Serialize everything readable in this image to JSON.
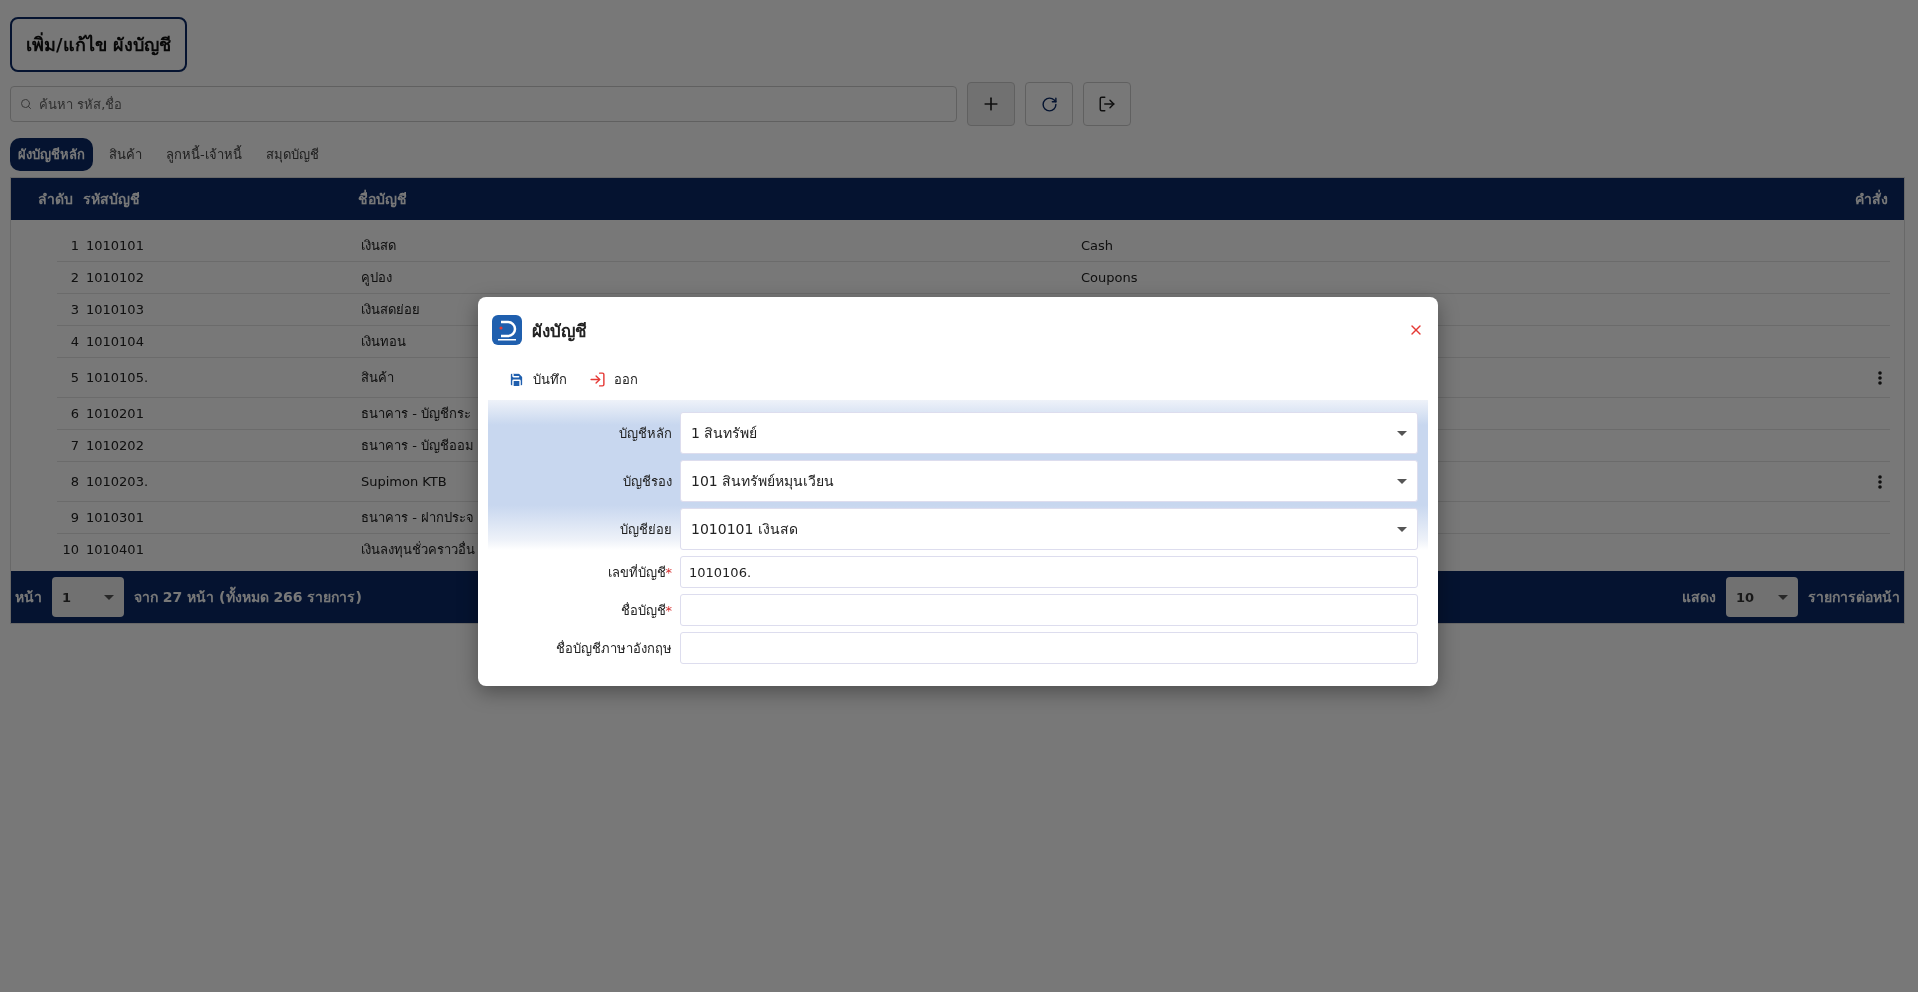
{
  "page": {
    "title": "เพิ่ม/แก้ไข ผังบัญชี"
  },
  "search": {
    "placeholder": "ค้นหา รหัส,ชื่อ"
  },
  "tabs": [
    {
      "label": "ผังบัญชีหลัก",
      "selected": true
    },
    {
      "label": "สินค้า",
      "selected": false
    },
    {
      "label": "ลูกหนี้-เจ้าหนี้",
      "selected": false
    },
    {
      "label": "สมุดบัญชี",
      "selected": false
    }
  ],
  "table": {
    "columns": [
      "ลำดับ",
      "รหัสบัญชี",
      "ชื่อบัญชี",
      "คำสั่ง"
    ],
    "rows": [
      {
        "order": "1",
        "code": "1010101",
        "name": "เงินสด",
        "name_en": "Cash",
        "menu": false
      },
      {
        "order": "2",
        "code": "1010102",
        "name": "คูปอง",
        "name_en": "Coupons",
        "menu": false
      },
      {
        "order": "3",
        "code": "1010103",
        "name": "เงินสดย่อย",
        "menu": false
      },
      {
        "order": "4",
        "code": "1010104",
        "name": "เงินทอน",
        "menu": false
      },
      {
        "order": "5",
        "code": "1010105.",
        "name": "สินค้า",
        "menu": true
      },
      {
        "order": "6",
        "code": "1010201",
        "name": "ธนาคาร - บัญชีกระ",
        "menu": false
      },
      {
        "order": "7",
        "code": "1010202",
        "name": "ธนาคาร - บัญชีออม",
        "menu": false
      },
      {
        "order": "8",
        "code": "1010203.",
        "name": "Supimon KTB",
        "menu": true
      },
      {
        "order": "9",
        "code": "1010301",
        "name": "ธนาคาร - ฝากประจ",
        "menu": false
      },
      {
        "order": "10",
        "code": "1010401",
        "name": "เงินลงทุนชั่วคราวอื่น",
        "menu": false
      }
    ]
  },
  "pagination": {
    "page_label": "หน้า",
    "page": "1",
    "summary": "จาก 27 หน้า (ทั้งหมด 266 รายการ)",
    "show_label": "แสดง",
    "per_page": "10",
    "per_page_label": "รายการต่อหน้า"
  },
  "dialog": {
    "title": "ผังบัญชี",
    "actions": [
      {
        "kind": "save",
        "label": "บันทึก"
      },
      {
        "kind": "exit",
        "label": "ออก"
      }
    ],
    "fields": [
      {
        "kind": "select",
        "label": "บัญชีหลัก",
        "value": "1 สินทรัพย์"
      },
      {
        "kind": "select",
        "label": "บัญชีรอง",
        "value": "101 สินทรัพย์หมุนเวียน"
      },
      {
        "kind": "select",
        "label": "บัญชีย่อย",
        "value": "1010101 เงินสด"
      },
      {
        "kind": "input",
        "label": "เลขที่บัญชี",
        "required_mark": "*",
        "value": "1010106."
      },
      {
        "kind": "input",
        "label": "ชื่อบัญชี",
        "required_mark": "*"
      },
      {
        "kind": "input",
        "label": "ชื่อบัญชีภาษาอังกฤษ"
      }
    ]
  }
}
